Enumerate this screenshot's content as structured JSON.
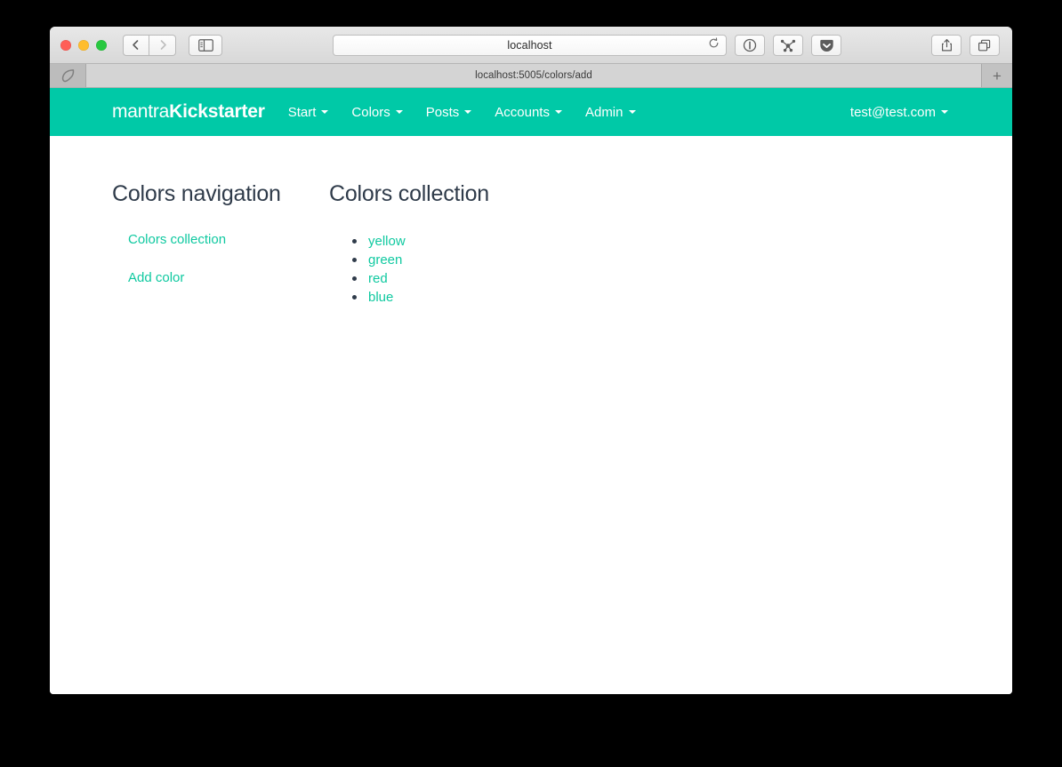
{
  "browser": {
    "address_value": "localhost",
    "tab_title": "localhost:5005/colors/add",
    "new_tab_label": "+",
    "icons": {
      "back": "back-arrow-icon",
      "forward": "forward-arrow-icon",
      "sidebar": "sidebar-toggle-icon",
      "reload": "reload-icon",
      "onepassword": "onepassword-icon",
      "share_extension": "share-node-icon",
      "pocket": "pocket-icon",
      "share": "share-icon",
      "tab_overview": "tab-overview-icon",
      "favicon": "site-favicon"
    },
    "traffic_lights": {
      "close": "#ff5f57",
      "minimize": "#ffbd2e",
      "zoom": "#28c840"
    }
  },
  "site": {
    "brand": {
      "light": "mantra",
      "bold": "Kickstarter"
    },
    "nav_items": [
      {
        "label": "Start",
        "has_caret": true
      },
      {
        "label": "Colors",
        "has_caret": true
      },
      {
        "label": "Posts",
        "has_caret": true
      },
      {
        "label": "Accounts",
        "has_caret": true
      },
      {
        "label": "Admin",
        "has_caret": true
      }
    ],
    "user_menu": {
      "label": "test@test.com",
      "has_caret": true
    },
    "theme": {
      "navbar_bg": "#00c9a7",
      "link_color": "#0fc9a0",
      "heading_color": "#2f3b4a"
    }
  },
  "content": {
    "nav_panel": {
      "title": "Colors navigation",
      "links": [
        {
          "label": "Colors collection"
        },
        {
          "label": "Add color"
        }
      ]
    },
    "collection_panel": {
      "title": "Colors collection",
      "items": [
        {
          "label": "yellow"
        },
        {
          "label": "green"
        },
        {
          "label": "red"
        },
        {
          "label": "blue"
        }
      ]
    }
  }
}
